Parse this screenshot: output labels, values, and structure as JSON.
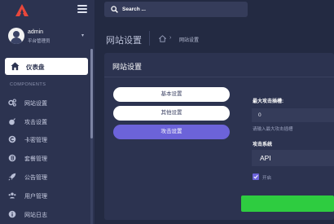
{
  "sidebar": {
    "profile": {
      "name": "admin",
      "role": "平台管理员"
    },
    "dashboard_label": "仪表盘",
    "section_title": "COMPONENTS",
    "items": [
      {
        "label": "网站设置",
        "icon": "gears-icon"
      },
      {
        "label": "攻击设置",
        "icon": "bomb-icon"
      },
      {
        "label": "卡密管理",
        "icon": "copyright-icon"
      },
      {
        "label": "套餐管理",
        "icon": "bitcoin-icon"
      },
      {
        "label": "公告管理",
        "icon": "rocket-icon"
      },
      {
        "label": "用户管理",
        "icon": "users-icon"
      },
      {
        "label": "网站日志",
        "icon": "info-icon"
      }
    ]
  },
  "search": {
    "placeholder": "Search ..."
  },
  "header": {
    "title": "网站设置",
    "breadcrumb": "网站设置"
  },
  "card": {
    "title": "网站设置",
    "tabs": [
      {
        "label": "基本设置",
        "active": false
      },
      {
        "label": "其他设置",
        "active": false
      },
      {
        "label": "攻击设置",
        "active": true
      }
    ],
    "max_attack": {
      "label": "最大攻击插槽:",
      "value": "0",
      "help": "请输入最大攻击插槽"
    },
    "attack_system": {
      "label": "攻击系统",
      "value": "API"
    },
    "checkbox": {
      "label": "开启",
      "checked": true
    }
  },
  "colors": {
    "accent": "#6c63d9",
    "success": "#2ecc40",
    "sidebar": "#2c3350",
    "background": "#232a42",
    "logo": "#e8473b"
  }
}
